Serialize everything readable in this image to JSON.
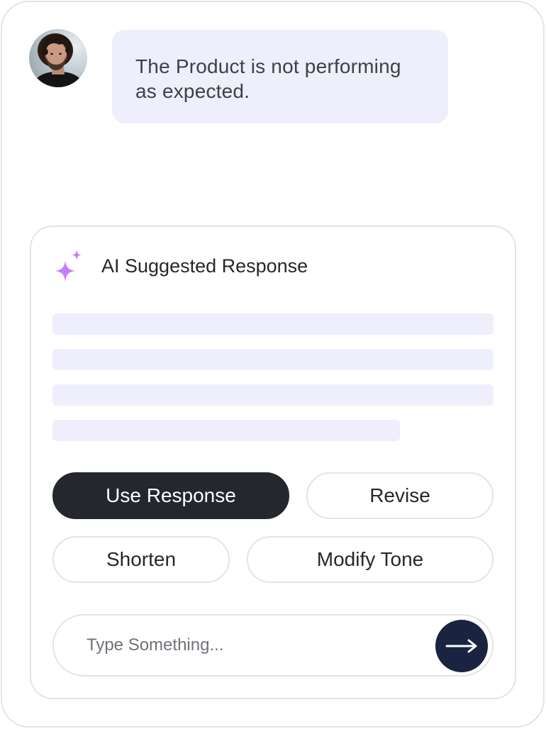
{
  "conversation": {
    "user_message": "The Product is not performing as expected."
  },
  "ai_panel": {
    "title": "AI Suggested Response",
    "icon": "sparkle-icon",
    "skeleton_line_count": 4
  },
  "actions": {
    "use_response": "Use Response",
    "revise": "Revise",
    "shorten": "Shorten",
    "modify_tone": "Modify Tone"
  },
  "composer": {
    "placeholder": "Type Something...",
    "send_icon": "arrow-right-icon"
  },
  "colors": {
    "bubble_bg": "#eeeefc",
    "primary_button": "#25272e",
    "send_button": "#1a2440",
    "sparkle": "#c77dff"
  }
}
